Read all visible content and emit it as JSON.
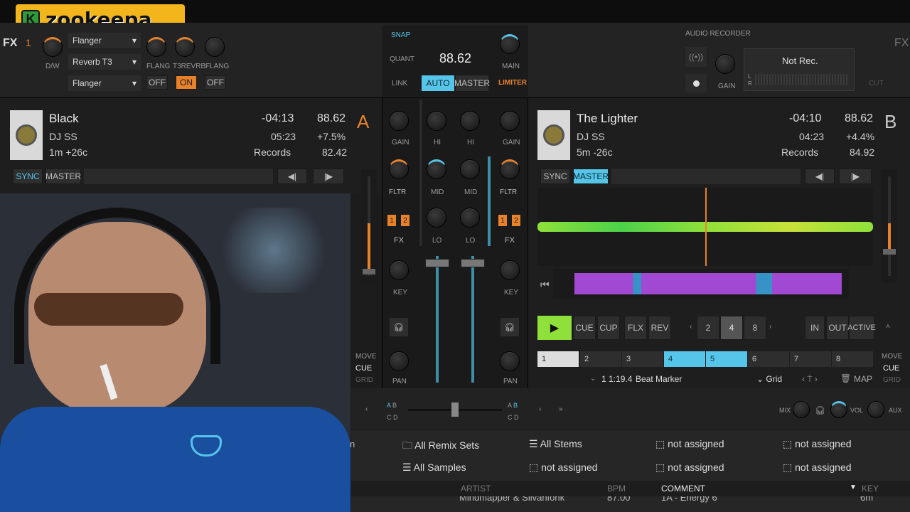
{
  "logo": {
    "text": "zookeepa",
    "badge": "K"
  },
  "fx": {
    "left_label": "FX",
    "right_label": "FX",
    "unit_id": "1",
    "dw_label": "D/W",
    "slots": [
      "Flanger",
      "Reverb T3",
      "Flanger"
    ],
    "knob_labels": [
      "FLANG",
      "T3REVRB",
      "FLANG"
    ],
    "buttons": [
      "OFF",
      "ON",
      "OFF"
    ]
  },
  "master": {
    "snap": "SNAP",
    "quant": "QUANT",
    "link": "LINK",
    "bpm": "88.62",
    "auto": "AUTO",
    "master": "MASTER",
    "main": "MAIN",
    "limiter": "LIMITER"
  },
  "recorder": {
    "title": "AUDIO RECORDER",
    "gain": "GAIN",
    "status": "Not Rec.",
    "l": "L",
    "r": "R",
    "cut": "CUT"
  },
  "deck_a": {
    "title": "Black",
    "artist": "DJ SS",
    "key": "1m +26c",
    "remaining": "-04:13",
    "time": "05:23",
    "label": "Records",
    "bpm": "88.62",
    "pitch": "+7.5%",
    "base_bpm": "82.42",
    "letter": "A",
    "sync": "SYNC",
    "master": "MASTER"
  },
  "deck_b": {
    "title": "The Lighter",
    "artist": "DJ SS",
    "key": "5m -26c",
    "remaining": "-04:10",
    "time": "04:23",
    "label": "Records",
    "bpm": "88.62",
    "pitch": "+4.4%",
    "base_bpm": "84.92",
    "letter": "B",
    "sync": "SYNC",
    "master": "MASTER",
    "transport": {
      "cue": "CUE",
      "cup": "CUP",
      "flx": "FLX",
      "rev": "REV"
    },
    "loops": [
      "2",
      "4",
      "8"
    ],
    "in": "IN",
    "out": "OUT",
    "active": "ACTIVE",
    "hotcues": [
      "1",
      "2",
      "3",
      "4",
      "5",
      "6",
      "7",
      "8"
    ],
    "marker_pos": "1 1:19.4",
    "marker_type": "Beat Marker",
    "grid": "Grid",
    "map": "MAP",
    "move": "MOVE",
    "move_cue": "CUE",
    "move_grid": "GRID"
  },
  "mixer": {
    "gain": "GAIN",
    "hi": "HI",
    "mid": "MID",
    "lo": "LO",
    "fltr": "FLTR",
    "fx": "FX",
    "key": "KEY",
    "pan": "PAN",
    "ch1": "1",
    "ch2": "2",
    "mix": "MIX",
    "vol": "VOL",
    "aux": "AUX",
    "xf_a": "A",
    "xf_b": "B",
    "xf_c": "C",
    "xf_d": "D",
    "left_move": "MOVE",
    "left_cue": "CUE",
    "left_grid": "GRID"
  },
  "browser": {
    "row1": [
      "All Remix Sets",
      "All Stems",
      "not assigned",
      "not assigned"
    ],
    "row2": [
      "All Samples",
      "not assigned",
      "not assigned",
      "not assigned"
    ],
    "columns": [
      "ARTIST",
      "BPM",
      "COMMENT",
      "KEY"
    ],
    "peek_row": [
      "Mindmapper & Silvanfonk",
      "87.00",
      "1A - Energy 6",
      "6m"
    ],
    "left_cut": "n"
  },
  "colors": {
    "orange": "#e8822a",
    "blue": "#56c5ea",
    "green": "#8fe03a",
    "purple": "#b04ee6"
  }
}
